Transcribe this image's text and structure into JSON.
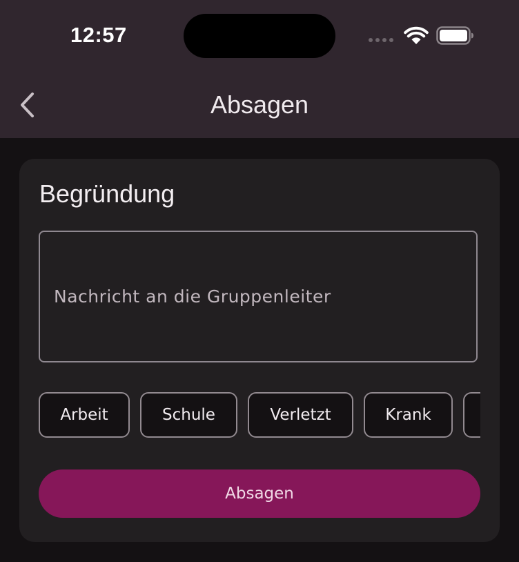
{
  "status_bar": {
    "time": "12:57",
    "icons": [
      "signal-icon",
      "wifi-icon",
      "battery-icon"
    ]
  },
  "app_bar": {
    "title": "Absagen",
    "back_icon": "chevron-left-icon"
  },
  "form": {
    "section_title": "Begründung",
    "message": {
      "value": "",
      "placeholder": "Nachricht an die Gruppenleiter"
    },
    "reason_chips": [
      "Arbeit",
      "Schule",
      "Verletzt",
      "Krank",
      ""
    ],
    "submit_label": "Absagen"
  },
  "colors": {
    "app_bar_bg": "#30262e",
    "page_bg": "#141113",
    "card_bg": "#221f21",
    "accent": "#861759",
    "chip_border": "#928a90"
  }
}
